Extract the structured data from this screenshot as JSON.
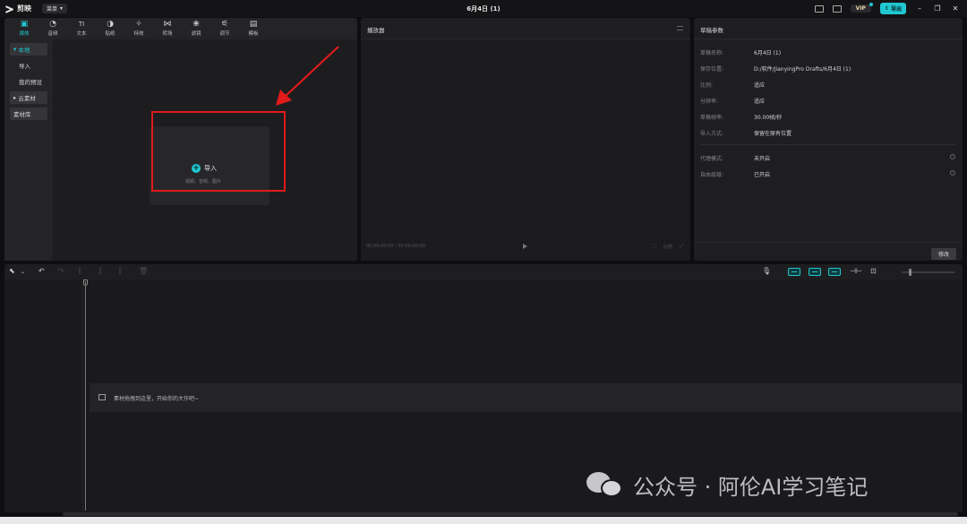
{
  "app": {
    "name": "剪映",
    "menu_label": "菜单",
    "doc_title": "6月4日 (1)",
    "vip_label": "VIP",
    "export_label": "导出"
  },
  "media_tabs": [
    {
      "label": "媒体",
      "icon": "media-icon",
      "active": true
    },
    {
      "label": "音频",
      "icon": "audio-icon"
    },
    {
      "label": "文本",
      "icon": "text-icon"
    },
    {
      "label": "贴纸",
      "icon": "sticker-icon"
    },
    {
      "label": "特效",
      "icon": "effects-icon"
    },
    {
      "label": "转场",
      "icon": "transition-icon"
    },
    {
      "label": "滤镜",
      "icon": "filter-icon"
    },
    {
      "label": "调节",
      "icon": "adjust-icon"
    },
    {
      "label": "模板",
      "icon": "template-icon"
    }
  ],
  "media_side": {
    "local": "本地",
    "import": "导入",
    "my_presets": "我的预设",
    "cloud": "云素材",
    "library": "素材库"
  },
  "import_card": {
    "label": "导入",
    "sub": "视频、音频、图片"
  },
  "player": {
    "title": "播放器",
    "time": "00:00:00:00 / 00:00:00:00",
    "ratio_label": "比例"
  },
  "params": {
    "title": "草稿参数",
    "rows": [
      {
        "k": "草稿名称:",
        "v": "6月4日 (1)"
      },
      {
        "k": "保存位置:",
        "v": "D:/软件/JianyingPro Drafts/6月4日 (1)"
      },
      {
        "k": "比例:",
        "v": "适应"
      },
      {
        "k": "分辨率:",
        "v": "适应"
      },
      {
        "k": "草稿帧率:",
        "v": "30.00帧/秒"
      },
      {
        "k": "导入方式:",
        "v": "保留在原有位置"
      }
    ],
    "rows2": [
      {
        "k": "代理模式:",
        "v": "未开启"
      },
      {
        "k": "自由层级:",
        "v": "已开启"
      }
    ],
    "modify_label": "修改"
  },
  "timeline": {
    "drop_hint": "素材拖拽到这里，开始你的大作吧~"
  },
  "watermark": {
    "text": "公众号 · 阿伦AI学习笔记"
  }
}
